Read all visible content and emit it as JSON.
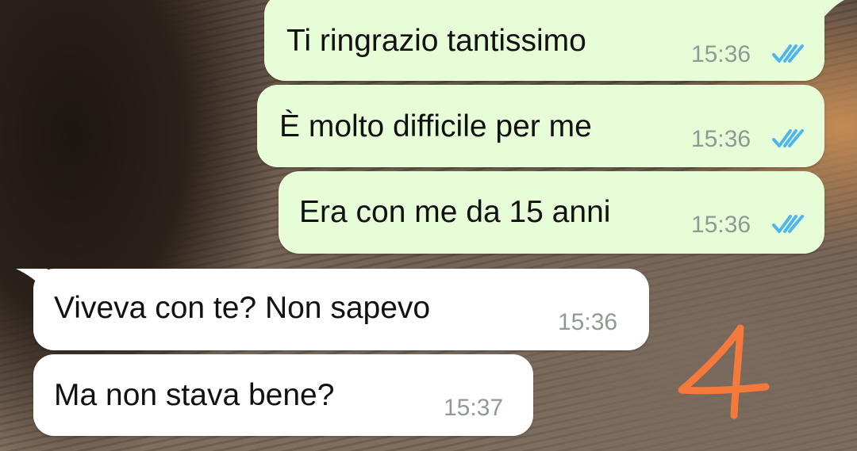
{
  "chat": {
    "messages": [
      {
        "direction": "outgoing",
        "text": "Ti ringrazio tantissimo",
        "time": "15:36",
        "status": "read-double-check-icon"
      },
      {
        "direction": "outgoing",
        "text": "È molto difficile per me",
        "time": "15:36",
        "status": "read-double-check-icon"
      },
      {
        "direction": "outgoing",
        "text": "Era con me da 15 anni",
        "time": "15:36",
        "status": "read-double-check-icon"
      },
      {
        "direction": "incoming",
        "text": "Viveva con te? Non sapevo",
        "time": "15:36"
      },
      {
        "direction": "incoming",
        "text": "Ma non stava bene?",
        "time": "15:37"
      }
    ]
  },
  "annotation": {
    "label": "4",
    "color": "#f47a3c"
  },
  "colors": {
    "outgoing_bubble": "#e7fdd8",
    "incoming_bubble": "#ffffff",
    "read_ticks": "#4fb6ec",
    "timestamp": "#8f9a93"
  }
}
